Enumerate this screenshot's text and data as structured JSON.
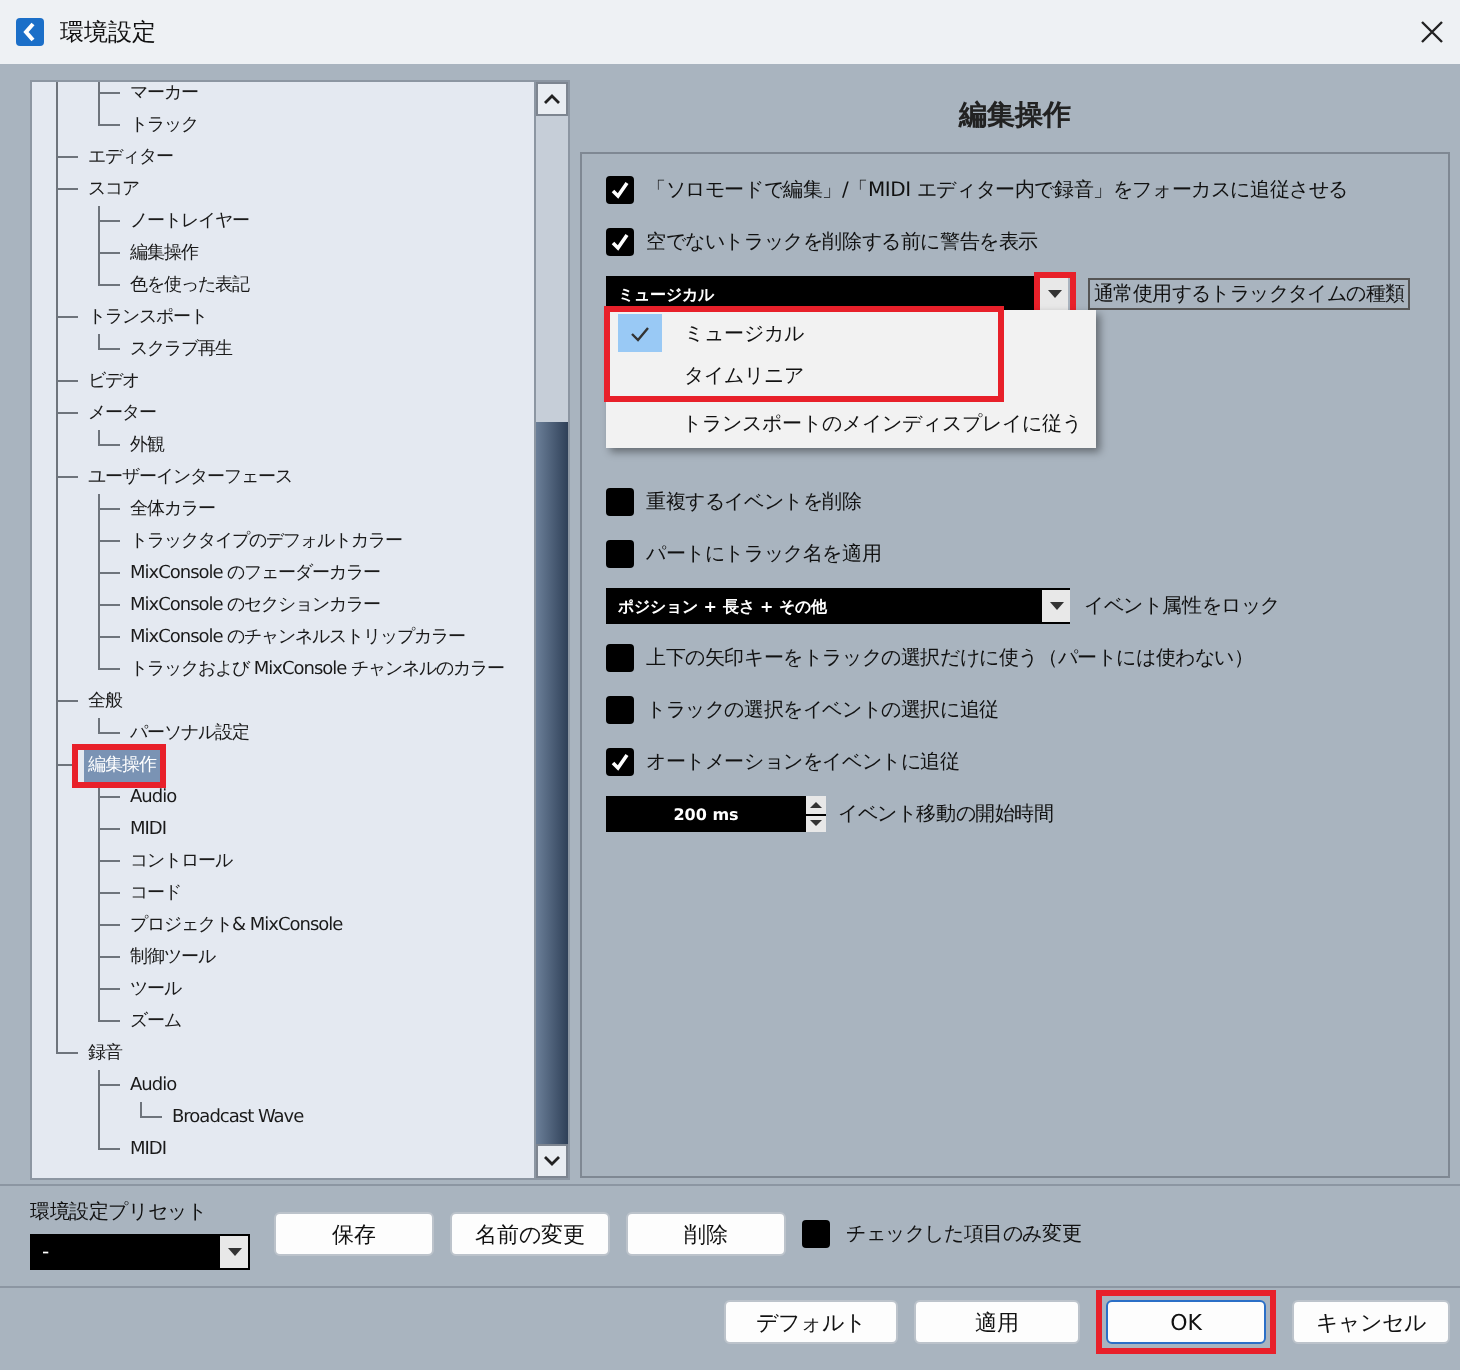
{
  "window": {
    "title": "環境設定"
  },
  "tree": [
    {
      "children": [
        {
          "label": "マーカー",
          "selected": false
        },
        {
          "label": "トラック",
          "selected": false
        }
      ]
    },
    {
      "label": "エディター",
      "selected": false
    },
    {
      "label": "スコア",
      "selected": false,
      "children": [
        {
          "label": "ノートレイヤー",
          "selected": false
        },
        {
          "label": "編集操作",
          "selected": false
        },
        {
          "label": "色を使った表記",
          "selected": false
        }
      ]
    },
    {
      "label": "トランスポート",
      "selected": false,
      "children": [
        {
          "label": "スクラブ再生",
          "selected": false
        }
      ]
    },
    {
      "label": "ビデオ",
      "selected": false
    },
    {
      "label": "メーター",
      "selected": false,
      "children": [
        {
          "label": "外観",
          "selected": false
        }
      ]
    },
    {
      "label": "ユーザーインターフェース",
      "selected": false,
      "children": [
        {
          "label": "全体カラー",
          "selected": false
        },
        {
          "label": "トラックタイプのデフォルトカラー",
          "selected": false
        },
        {
          "label": "MixConsole のフェーダーカラー",
          "selected": false
        },
        {
          "label": "MixConsole のセクションカラー",
          "selected": false
        },
        {
          "label": "MixConsole のチャンネルストリップカラー",
          "selected": false
        },
        {
          "label": "トラックおよび MixConsole チャンネルのカラー",
          "selected": false
        }
      ]
    },
    {
      "label": "全般",
      "selected": false,
      "children": [
        {
          "label": "パーソナル設定",
          "selected": false
        }
      ]
    },
    {
      "label": "編集操作",
      "selected": true,
      "annotated": true,
      "children": [
        {
          "label": "Audio",
          "selected": false
        },
        {
          "label": "MIDI",
          "selected": false
        },
        {
          "label": "コントロール",
          "selected": false
        },
        {
          "label": "コード",
          "selected": false
        },
        {
          "label": "プロジェクト& MixConsole",
          "selected": false
        },
        {
          "label": "制御ツール",
          "selected": false
        },
        {
          "label": "ツール",
          "selected": false
        },
        {
          "label": "ズーム",
          "selected": false
        }
      ]
    },
    {
      "label": "録音",
      "selected": false,
      "children": [
        {
          "label": "Audio",
          "selected": false,
          "children": [
            {
              "label": "Broadcast Wave",
              "selected": false
            }
          ]
        },
        {
          "label": "MIDI",
          "selected": false
        }
      ]
    }
  ],
  "heading": "編集操作",
  "settings": [
    {
      "kind": "checkbox",
      "label": "「ソロモードで編集」/「MIDI エディター内で録音」をフォーカスに追従させる",
      "checked": true
    },
    {
      "kind": "checkbox",
      "label": "空でないトラックを削除する前に警告を表示",
      "checked": true
    },
    {
      "kind": "select",
      "value": "ミュージカル",
      "caption": "通常使用するトラックタイムの種類",
      "annotated": true,
      "menu": [
        {
          "label": "ミュージカル",
          "selected": true,
          "annotated": true
        },
        {
          "label": "タイムリニア",
          "selected": false,
          "annotated": true
        },
        {
          "label": "トランスポートのメインディスプレイに従う",
          "selected": false,
          "annotated": false
        }
      ]
    },
    {
      "kind": "covered"
    },
    {
      "kind": "covered"
    },
    {
      "kind": "covered"
    },
    {
      "kind": "checkbox",
      "label": "重複するイベントを削除",
      "checked": false
    },
    {
      "kind": "checkbox",
      "label": "パートにトラック名を適用",
      "checked": false
    },
    {
      "kind": "select",
      "value": "ポジション + 長さ + その他",
      "caption": "イベント属性をロック"
    },
    {
      "kind": "checkbox",
      "label": "上下の矢印キーをトラックの選択だけに使う（パートには使わない）",
      "checked": false
    },
    {
      "kind": "checkbox",
      "label": "トラックの選択をイベントの選択に追従",
      "checked": false
    },
    {
      "kind": "checkbox",
      "label": "オートメーションをイベントに追従",
      "checked": true
    },
    {
      "kind": "spinner",
      "value": "200 ms",
      "caption": "イベント移動の開始時間"
    }
  ],
  "preset": {
    "label": "環境設定プリセット",
    "value": "-",
    "buttons": [
      "保存",
      "名前の変更",
      "削除"
    ],
    "checkbox": {
      "label": "チェックした項目のみ変更",
      "checked": false
    }
  },
  "footer": [
    {
      "label": "デフォルト",
      "primary": false
    },
    {
      "label": "適用",
      "primary": false
    },
    {
      "label": "OK",
      "annotated": true,
      "primary": true
    },
    {
      "label": "キャンセル",
      "primary": false
    }
  ]
}
